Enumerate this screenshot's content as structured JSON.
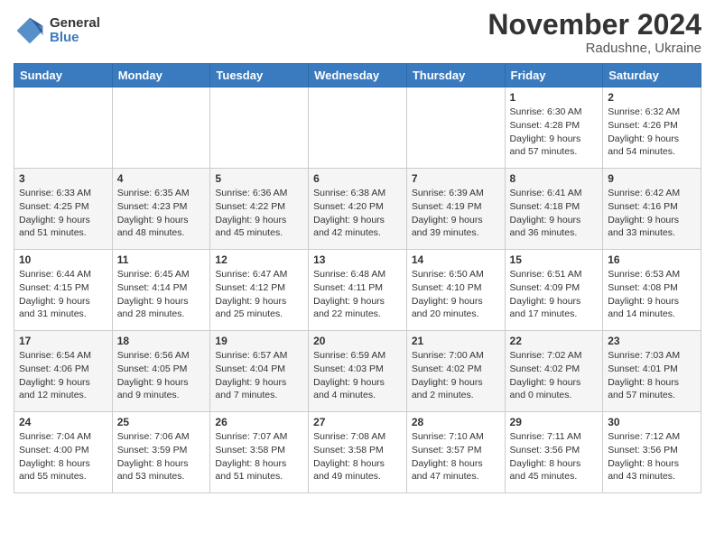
{
  "header": {
    "logo": {
      "general": "General",
      "blue": "Blue"
    },
    "title": "November 2024",
    "location": "Radushne, Ukraine"
  },
  "weekdays": [
    "Sunday",
    "Monday",
    "Tuesday",
    "Wednesday",
    "Thursday",
    "Friday",
    "Saturday"
  ],
  "weeks": [
    [
      {
        "day": "",
        "info": ""
      },
      {
        "day": "",
        "info": ""
      },
      {
        "day": "",
        "info": ""
      },
      {
        "day": "",
        "info": ""
      },
      {
        "day": "",
        "info": ""
      },
      {
        "day": "1",
        "info": "Sunrise: 6:30 AM\nSunset: 4:28 PM\nDaylight: 9 hours\nand 57 minutes."
      },
      {
        "day": "2",
        "info": "Sunrise: 6:32 AM\nSunset: 4:26 PM\nDaylight: 9 hours\nand 54 minutes."
      }
    ],
    [
      {
        "day": "3",
        "info": "Sunrise: 6:33 AM\nSunset: 4:25 PM\nDaylight: 9 hours\nand 51 minutes."
      },
      {
        "day": "4",
        "info": "Sunrise: 6:35 AM\nSunset: 4:23 PM\nDaylight: 9 hours\nand 48 minutes."
      },
      {
        "day": "5",
        "info": "Sunrise: 6:36 AM\nSunset: 4:22 PM\nDaylight: 9 hours\nand 45 minutes."
      },
      {
        "day": "6",
        "info": "Sunrise: 6:38 AM\nSunset: 4:20 PM\nDaylight: 9 hours\nand 42 minutes."
      },
      {
        "day": "7",
        "info": "Sunrise: 6:39 AM\nSunset: 4:19 PM\nDaylight: 9 hours\nand 39 minutes."
      },
      {
        "day": "8",
        "info": "Sunrise: 6:41 AM\nSunset: 4:18 PM\nDaylight: 9 hours\nand 36 minutes."
      },
      {
        "day": "9",
        "info": "Sunrise: 6:42 AM\nSunset: 4:16 PM\nDaylight: 9 hours\nand 33 minutes."
      }
    ],
    [
      {
        "day": "10",
        "info": "Sunrise: 6:44 AM\nSunset: 4:15 PM\nDaylight: 9 hours\nand 31 minutes."
      },
      {
        "day": "11",
        "info": "Sunrise: 6:45 AM\nSunset: 4:14 PM\nDaylight: 9 hours\nand 28 minutes."
      },
      {
        "day": "12",
        "info": "Sunrise: 6:47 AM\nSunset: 4:12 PM\nDaylight: 9 hours\nand 25 minutes."
      },
      {
        "day": "13",
        "info": "Sunrise: 6:48 AM\nSunset: 4:11 PM\nDaylight: 9 hours\nand 22 minutes."
      },
      {
        "day": "14",
        "info": "Sunrise: 6:50 AM\nSunset: 4:10 PM\nDaylight: 9 hours\nand 20 minutes."
      },
      {
        "day": "15",
        "info": "Sunrise: 6:51 AM\nSunset: 4:09 PM\nDaylight: 9 hours\nand 17 minutes."
      },
      {
        "day": "16",
        "info": "Sunrise: 6:53 AM\nSunset: 4:08 PM\nDaylight: 9 hours\nand 14 minutes."
      }
    ],
    [
      {
        "day": "17",
        "info": "Sunrise: 6:54 AM\nSunset: 4:06 PM\nDaylight: 9 hours\nand 12 minutes."
      },
      {
        "day": "18",
        "info": "Sunrise: 6:56 AM\nSunset: 4:05 PM\nDaylight: 9 hours\nand 9 minutes."
      },
      {
        "day": "19",
        "info": "Sunrise: 6:57 AM\nSunset: 4:04 PM\nDaylight: 9 hours\nand 7 minutes."
      },
      {
        "day": "20",
        "info": "Sunrise: 6:59 AM\nSunset: 4:03 PM\nDaylight: 9 hours\nand 4 minutes."
      },
      {
        "day": "21",
        "info": "Sunrise: 7:00 AM\nSunset: 4:02 PM\nDaylight: 9 hours\nand 2 minutes."
      },
      {
        "day": "22",
        "info": "Sunrise: 7:02 AM\nSunset: 4:02 PM\nDaylight: 9 hours\nand 0 minutes."
      },
      {
        "day": "23",
        "info": "Sunrise: 7:03 AM\nSunset: 4:01 PM\nDaylight: 8 hours\nand 57 minutes."
      }
    ],
    [
      {
        "day": "24",
        "info": "Sunrise: 7:04 AM\nSunset: 4:00 PM\nDaylight: 8 hours\nand 55 minutes."
      },
      {
        "day": "25",
        "info": "Sunrise: 7:06 AM\nSunset: 3:59 PM\nDaylight: 8 hours\nand 53 minutes."
      },
      {
        "day": "26",
        "info": "Sunrise: 7:07 AM\nSunset: 3:58 PM\nDaylight: 8 hours\nand 51 minutes."
      },
      {
        "day": "27",
        "info": "Sunrise: 7:08 AM\nSunset: 3:58 PM\nDaylight: 8 hours\nand 49 minutes."
      },
      {
        "day": "28",
        "info": "Sunrise: 7:10 AM\nSunset: 3:57 PM\nDaylight: 8 hours\nand 47 minutes."
      },
      {
        "day": "29",
        "info": "Sunrise: 7:11 AM\nSunset: 3:56 PM\nDaylight: 8 hours\nand 45 minutes."
      },
      {
        "day": "30",
        "info": "Sunrise: 7:12 AM\nSunset: 3:56 PM\nDaylight: 8 hours\nand 43 minutes."
      }
    ]
  ]
}
